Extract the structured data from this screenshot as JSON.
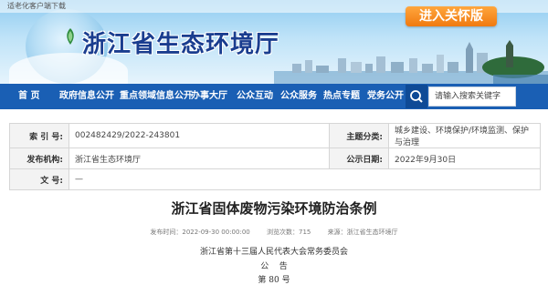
{
  "topbar": {
    "elder_client_download": "适老化客户端下载"
  },
  "header": {
    "site_title": "浙江省生态环境厅",
    "care_version_button": "进入关怀版"
  },
  "nav": {
    "items": [
      "首 页",
      "政府信息公开",
      "重点领域信息公开",
      "办事大厅",
      "公众互动",
      "公众服务",
      "热点专题",
      "党务公开"
    ],
    "search_placeholder": "请输入搜索关键字"
  },
  "info": {
    "index_label": "索 引 号:",
    "index_value": "002482429/2022-243801",
    "topic_label": "主题分类:",
    "topic_value": "城乡建设、环境保护/环境监测、保护与治理",
    "publisher_label": "发布机构:",
    "publisher_value": "浙江省生态环境厅",
    "date_label": "公示日期:",
    "date_value": "2022年9月30日",
    "doc_no_label": "文  号:",
    "doc_no_value": "—"
  },
  "document": {
    "title": "浙江省固体废物污染环境防治条例",
    "meta_time": "发布时间：2022-09-30 00:00:00",
    "meta_views": "浏览次数：715",
    "meta_source": "来源：浙江省生态环境厅",
    "issuer": "浙江省第十三届人民代表大会常务委员会",
    "announcement": "公    告",
    "number": "第 80 号"
  }
}
